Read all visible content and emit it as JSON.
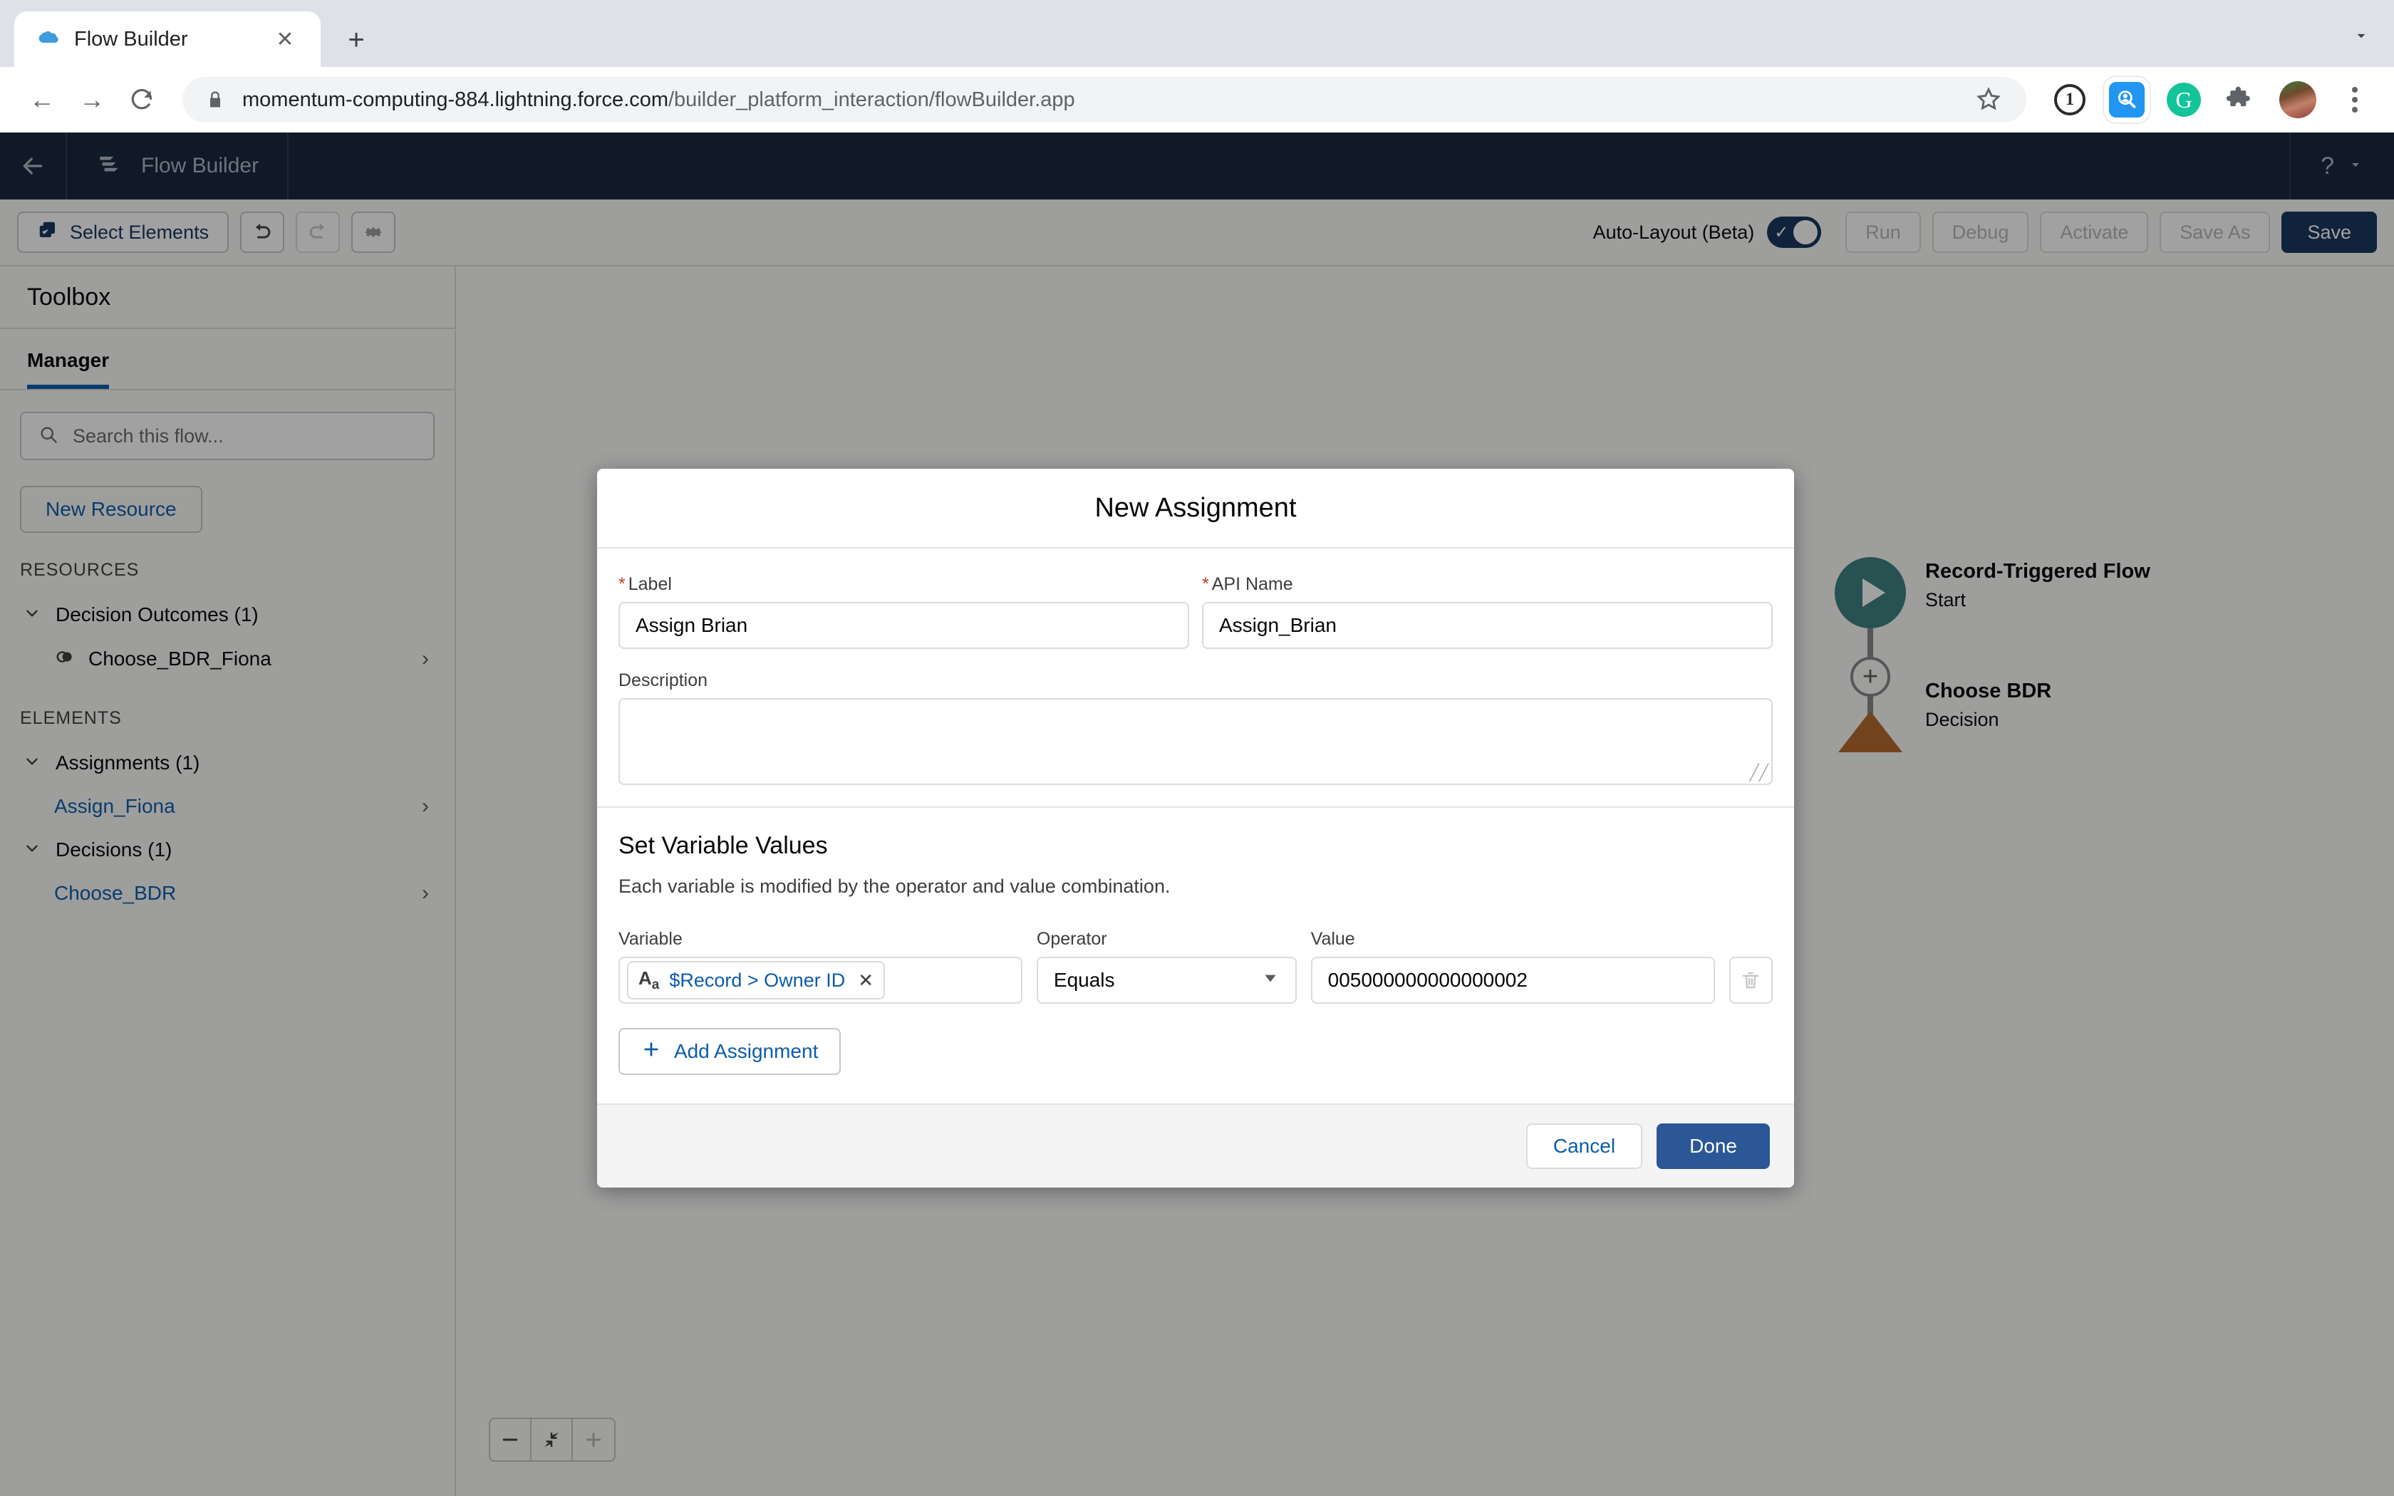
{
  "browser": {
    "tab": {
      "title": "Flow Builder",
      "favicon_icon": "salesforce-cloud-icon",
      "close_icon": "close-icon"
    },
    "new_tab_icon": "plus-icon",
    "tabstrip_caret_icon": "chevron-down-icon",
    "nav": {
      "back_icon": "arrow-left-icon",
      "forward_icon": "arrow-right-icon",
      "reload_icon": "reload-icon"
    },
    "omnibox": {
      "lock_icon": "lock-icon",
      "url_domain": "momentum-computing-884.lightning.force.com",
      "url_path": "/builder_platform_interaction/flowBuilder.app",
      "star_icon": "star-icon"
    },
    "extensions": [
      {
        "name": "onepassword-icon",
        "glyph": "1"
      },
      {
        "name": "search-person-extension-icon",
        "glyph": "⚲"
      },
      {
        "name": "grammarly-icon",
        "glyph": "G"
      },
      {
        "name": "puzzle-extensions-icon",
        "glyph": "❖"
      }
    ],
    "avatar_name": "user-avatar",
    "menu_icon": "kebab-menu-icon"
  },
  "app_header": {
    "back_icon": "arrow-left-icon",
    "flow_icon": "flow-builder-icon",
    "title": "Flow Builder",
    "help_icon": "question-mark-icon",
    "help_caret_icon": "chevron-down-icon"
  },
  "toolbar": {
    "select_elements_label": "Select Elements",
    "select_elements_icon": "select-elements-icon",
    "undo_icon": "undo-icon",
    "redo_icon": "redo-icon",
    "settings_icon": "gear-icon",
    "auto_layout_label": "Auto-Layout (Beta)",
    "auto_layout_on": true,
    "toggle_check_glyph": "✓",
    "buttons": [
      {
        "label": "Run",
        "enabled": false
      },
      {
        "label": "Debug",
        "enabled": false
      },
      {
        "label": "Activate",
        "enabled": false
      },
      {
        "label": "Save As",
        "enabled": false
      },
      {
        "label": "Save",
        "enabled": true
      }
    ]
  },
  "sidebar": {
    "title": "Toolbox",
    "tab_label": "Manager",
    "search_placeholder": "Search this flow...",
    "search_icon": "search-icon",
    "new_resource_label": "New Resource",
    "resources_label": "RESOURCES",
    "elements_label": "ELEMENTS",
    "groups": [
      {
        "label": "Decision Outcomes (1)",
        "chevron_icon": "chevron-down-icon",
        "items": [
          {
            "label": "Choose_BDR_Fiona",
            "icon": "outcome-circles-icon",
            "is_link": false,
            "chevron_icon": "chevron-right-icon"
          }
        ]
      },
      {
        "label": "Assignments (1)",
        "chevron_icon": "chevron-down-icon",
        "items": [
          {
            "label": "Assign_Fiona",
            "icon": "",
            "is_link": true,
            "chevron_icon": "chevron-right-icon"
          }
        ]
      },
      {
        "label": "Decisions (1)",
        "chevron_icon": "chevron-down-icon",
        "items": [
          {
            "label": "Choose_BDR",
            "icon": "",
            "is_link": true,
            "chevron_icon": "chevron-right-icon"
          }
        ]
      }
    ]
  },
  "canvas": {
    "start_node": {
      "title": "Record-Triggered Flow",
      "subtitle": "Start",
      "icon": "play-icon",
      "color": "#3c7f7f"
    },
    "decision_node": {
      "title": "Choose BDR",
      "subtitle": "Decision",
      "color": "#b5682a"
    },
    "add_connector_icon": "plus-circle-icon",
    "zoom": {
      "out_icon": "minus-icon",
      "fit_icon": "fit-to-view-icon",
      "in_icon": "plus-icon"
    }
  },
  "modal": {
    "title": "New Assignment",
    "close_icon": "close-icon",
    "label_field": {
      "label": "Label",
      "required": true,
      "value": "Assign Brian"
    },
    "api_name_field": {
      "label": "API Name",
      "required": true,
      "value": "Assign_Brian"
    },
    "description_field": {
      "label": "Description",
      "value": "",
      "resize_glyph": "╱╱"
    },
    "set_variable_values": {
      "heading": "Set Variable Values",
      "description": "Each variable is modified by the operator and value combination.",
      "columns": {
        "variable": "Variable",
        "operator": "Operator",
        "value": "Value"
      },
      "rows": [
        {
          "variable_pill_text": "$Record > Owner ID",
          "variable_pill_type_icon": "text-type-icon",
          "variable_pill_remove_icon": "close-icon",
          "operator": "Equals",
          "operator_caret_icon": "chevron-down-icon",
          "value": "005000000000000002",
          "delete_icon": "trash-icon"
        }
      ],
      "add_assignment_label": "Add Assignment",
      "add_assignment_icon": "plus-icon"
    },
    "footer": {
      "cancel_label": "Cancel",
      "done_label": "Done"
    }
  }
}
